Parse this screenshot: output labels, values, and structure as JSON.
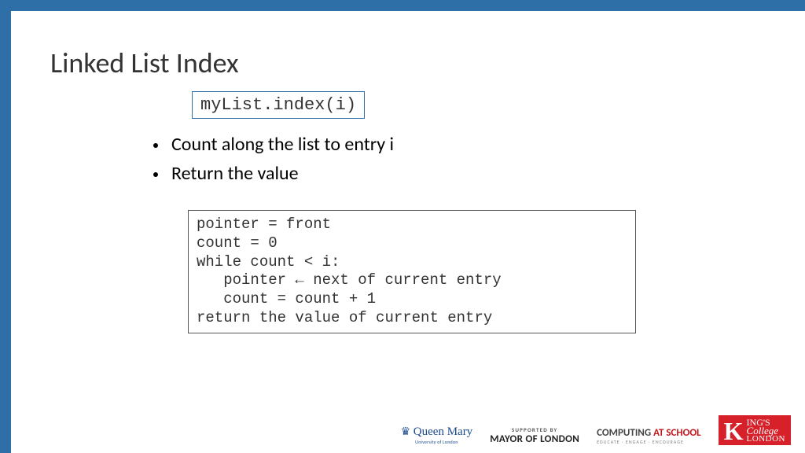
{
  "title": "Linked List Index",
  "inline_code": "myList.index(i)",
  "bullets": [
    "Count along the list to entry i",
    "Return the value"
  ],
  "code": "pointer = front\ncount = 0\nwhile count < i:\n   pointer ← next of current entry\n   count = count + 1\nreturn the value of current entry",
  "footer": {
    "qm": {
      "crown": "♛",
      "text": "Queen Mary",
      "sub": "University of London"
    },
    "mol": {
      "supported": "SUPPORTED BY",
      "main": "MAYOR OF LONDON"
    },
    "cas": {
      "main1": "COMPUTING ",
      "main2": "AT SCHOOL",
      "sub": "EDUCATE · ENGAGE · ENCOURAGE"
    },
    "kcl": {
      "k": "K",
      "ings": "ING'S",
      "college": "College",
      "london": "LONDON"
    }
  }
}
